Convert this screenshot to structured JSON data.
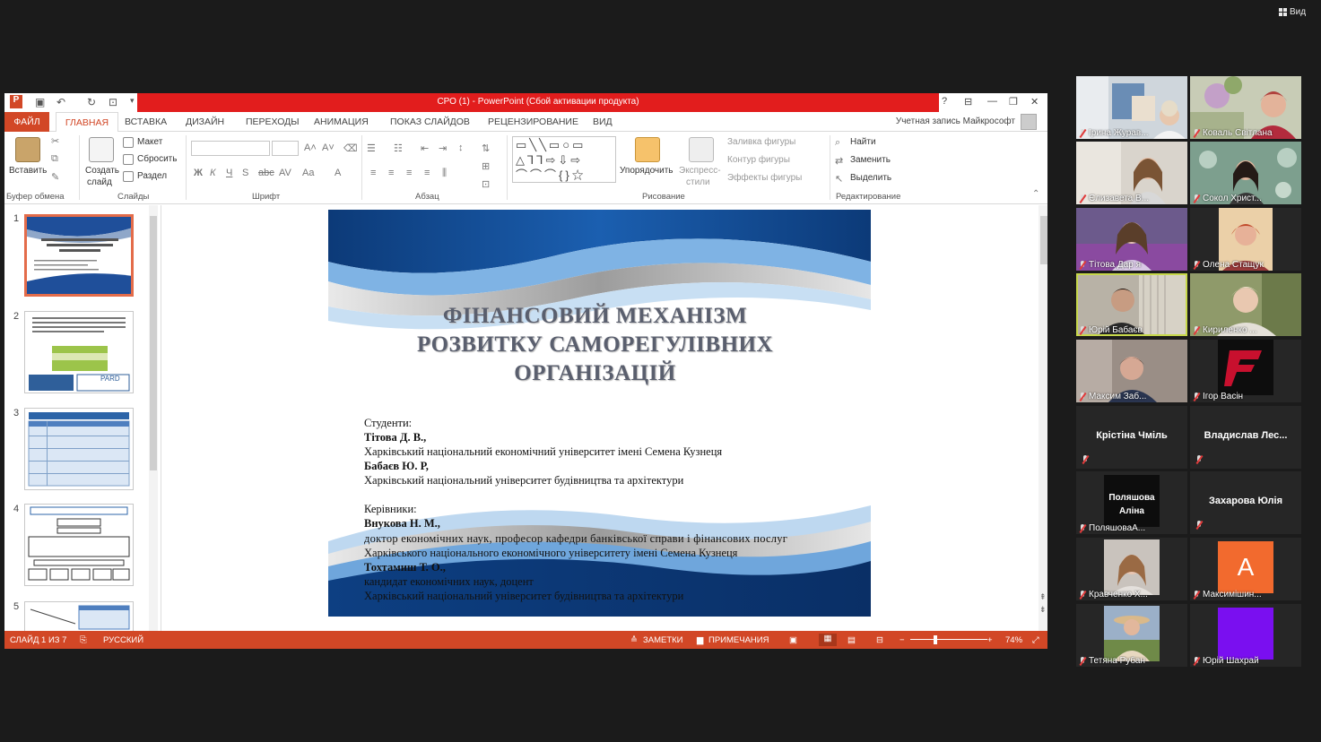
{
  "zoom": {
    "view_label": "Вид"
  },
  "ppt": {
    "window_title": "СРО (1) - PowerPoint (Сбой активации продукта)",
    "tabs": {
      "file": "ФАЙЛ",
      "home": "ГЛАВНАЯ",
      "insert": "ВСТАВКА",
      "design": "ДИЗАЙН",
      "transitions": "ПЕРЕХОДЫ",
      "animation": "АНИМАЦИЯ",
      "slideshow": "ПОКАЗ СЛАЙДОВ",
      "review": "РЕЦЕНЗИРОВАНИЕ",
      "view": "ВИД"
    },
    "account": "Учетная запись Майкрософт",
    "ribbon": {
      "paste": "Вставить",
      "clipboard": "Буфер обмена",
      "new_slide_1": "Создать",
      "new_slide_2": "слайд",
      "layout": "Макет",
      "reset": "Сбросить",
      "section": "Раздел",
      "slides": "Слайды",
      "font": "Шрифт",
      "paragraph": "Абзац",
      "arrange": "Упорядочить",
      "quick_styles_1": "Экспресс-",
      "quick_styles_2": "стили",
      "shape_fill": "Заливка фигуры",
      "shape_outline": "Контур фигуры",
      "shape_effects": "Эффекты фигуры",
      "drawing": "Рисование",
      "find": "Найти",
      "replace": "Заменить",
      "select": "Выделить",
      "editing": "Редактирование"
    },
    "thumbnails": [
      "1",
      "2",
      "3",
      "4",
      "5"
    ],
    "thumb2_label": "PARD",
    "slide": {
      "title_lines": [
        "ФІНАНСОВИЙ МЕХАНІЗМ",
        "РОЗВИТКУ САМОРЕГУЛІВНИХ",
        "ОРГАНІЗАЦІЙ"
      ],
      "students_label": "Студенти:",
      "student1": "Тітова Д. В.,",
      "student1_uni": "Харківський національний економічний університет імені Семена Кузнеця",
      "student2": "Бабаєв Ю. Р,",
      "student2_uni": "Харківський національний університет будівництва та архітектури",
      "supervisors_label": "Керівники:",
      "sup1": "Внукова Н. М.,",
      "sup1_title": "доктор економічних наук, професор кафедри банківської справи і фінансових послуг",
      "sup1_uni": "Харківського національного економічного університету  імені Семена Кузнеця",
      "sup2": "Тохтамиш Т. О.,",
      "sup2_title": "кандидат економічних наук, доцент",
      "sup2_uni": "Харківський національний університет будівництва та архітектури"
    },
    "status": {
      "slide_of": "СЛАЙД 1 ИЗ 7",
      "language": "РУССКИЙ",
      "notes": "ЗАМЕТКИ",
      "comments": "ПРИМЕЧАНИЯ",
      "zoom": "74%"
    }
  },
  "participants": [
    {
      "name": "Ірина Журав..."
    },
    {
      "name": "Коваль Світлана"
    },
    {
      "name": "Єлизавета В..."
    },
    {
      "name": "Сокол Христ..."
    },
    {
      "name": "Тітова Дар я"
    },
    {
      "name": "Олена Стащук"
    },
    {
      "name": "Юрій Бабаєв"
    },
    {
      "name": "Кириленко ..."
    },
    {
      "name": "Максим Заб..."
    },
    {
      "name": "Ігор Васін"
    },
    {
      "name": "Крістіна Чміль"
    },
    {
      "name": "Владислав  Лес..."
    },
    {
      "name": "ПоляшоваА...",
      "tile_text_1": "Поляшова",
      "tile_text_2": "Аліна"
    },
    {
      "name": "Захарова Юлія"
    },
    {
      "name": "Кравченко Х..."
    },
    {
      "name": "Максимішин...",
      "avatar_letter": "А"
    },
    {
      "name": "Тетяна Рубан"
    },
    {
      "name": "Юрій Шахрай"
    }
  ]
}
